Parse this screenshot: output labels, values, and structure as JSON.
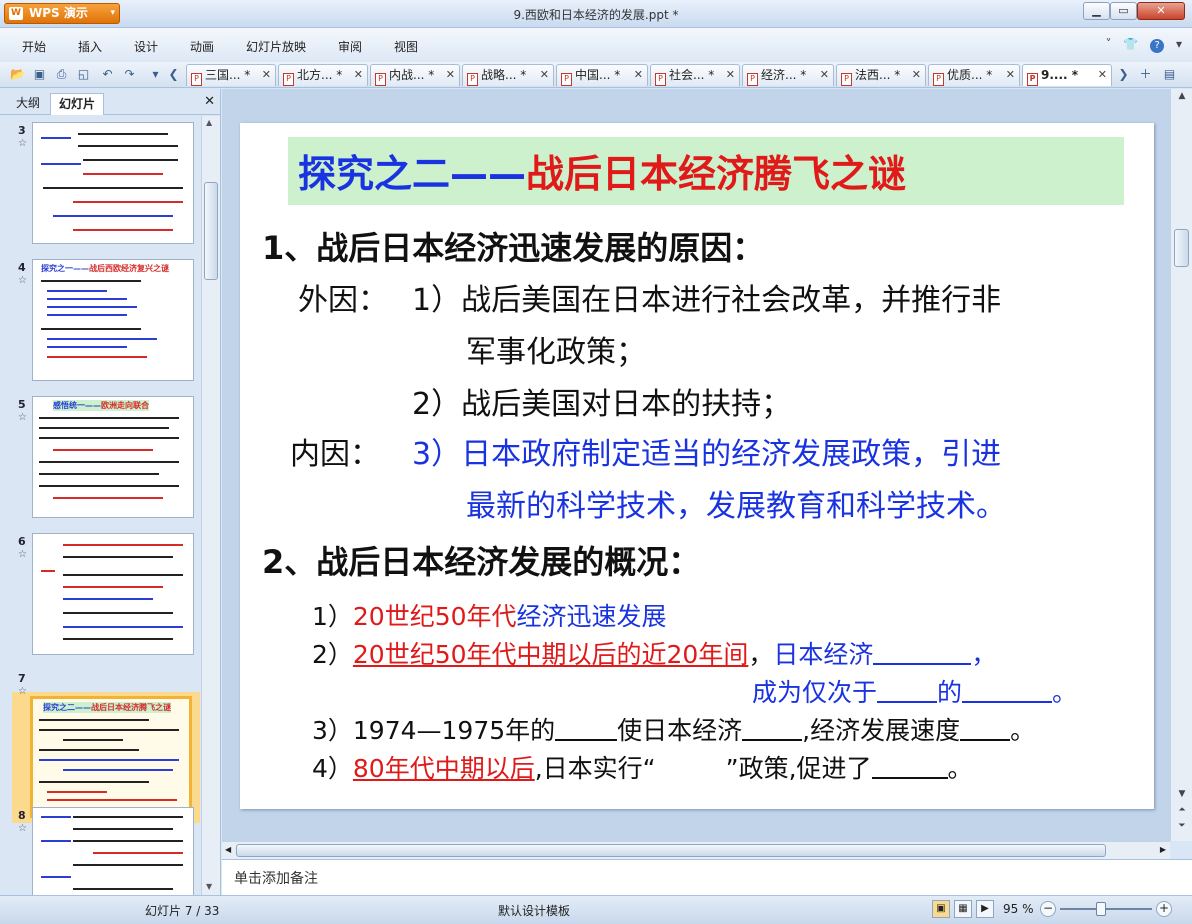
{
  "app": {
    "name": "WPS 演示",
    "window_title": "9.西欧和日本经济的发展.ppt *"
  },
  "menu": [
    "开始",
    "插入",
    "设计",
    "动画",
    "幻灯片放映",
    "审阅",
    "视图"
  ],
  "tabs": [
    {
      "label": "三国...",
      "mod": "*"
    },
    {
      "label": "北方...",
      "mod": "*"
    },
    {
      "label": "内战...",
      "mod": "*"
    },
    {
      "label": "战略...",
      "mod": "*"
    },
    {
      "label": "中国...",
      "mod": "*"
    },
    {
      "label": "社会...",
      "mod": "*"
    },
    {
      "label": "经济...",
      "mod": "*"
    },
    {
      "label": "法西...",
      "mod": "*"
    },
    {
      "label": "优质...",
      "mod": "*"
    },
    {
      "label": "9....",
      "mod": "*"
    }
  ],
  "left_panel": {
    "tab_outline": "大纲",
    "tab_slides": "幻灯片",
    "thumbnails": [
      {
        "num": "3",
        "star": "☆"
      },
      {
        "num": "4",
        "star": "☆",
        "title_b": "探究之一——",
        "title_r": "战后西欧经济复兴之谜"
      },
      {
        "num": "5",
        "star": "☆",
        "title_b": "感悟统一——",
        "title_r": "欧洲走向联合"
      },
      {
        "num": "6",
        "star": "☆"
      },
      {
        "num": "7",
        "star": "☆",
        "title_b": "探究之二——",
        "title_r": "战后日本经济腾飞之谜"
      },
      {
        "num": "8",
        "star": "☆"
      }
    ]
  },
  "slide": {
    "title_part1": "探究之二",
    "title_dash": "——",
    "title_part2": "战后日本经济腾飞之谜",
    "h1": "1、战后日本经济迅速发展的原因：",
    "ext_label": "外因：",
    "ext1_a": "1）战后美国在日本进行社会改革，并推行非",
    "ext1_b": "军事化政策；",
    "ext2": "2）战后美国对日本的扶持；",
    "int_label": "内因：",
    "int3_a": "3）日本政府制定适当的经济发展政策，引进",
    "int3_b": "最新的科学技术，发展教育和科学技术。",
    "h2": "2、战后日本经济发展的概况：",
    "o1_num": "1）",
    "o1_red": "20世纪50年代",
    "o1_blue": "经济迅速发展",
    "o2_num": "2）",
    "o2_red": "20世纪50年代中期以后的近20年间",
    "o2_comma": "，",
    "o2_blue": "日本经济",
    "o2_tail": "，",
    "o2b_blue1": "成为仅次于",
    "o2b_blue2": "的",
    "o2b_end": "。",
    "o3_a": "3）1974—1975年的",
    "o3_b": "使日本经济",
    "o3_c": ",经济发展速度",
    "o3_d": "。",
    "o4_num": "4）",
    "o4_red": "80年代中期以后",
    "o4_a": ",日本实行“",
    "o4_b": "”政策,促进了",
    "o4_end": "。"
  },
  "notes_placeholder": "单击添加备注",
  "status": {
    "slide_info": "幻灯片 7 / 33",
    "template": "默认设计模板",
    "zoom": "95 %",
    "zoom_level": 0.95
  }
}
